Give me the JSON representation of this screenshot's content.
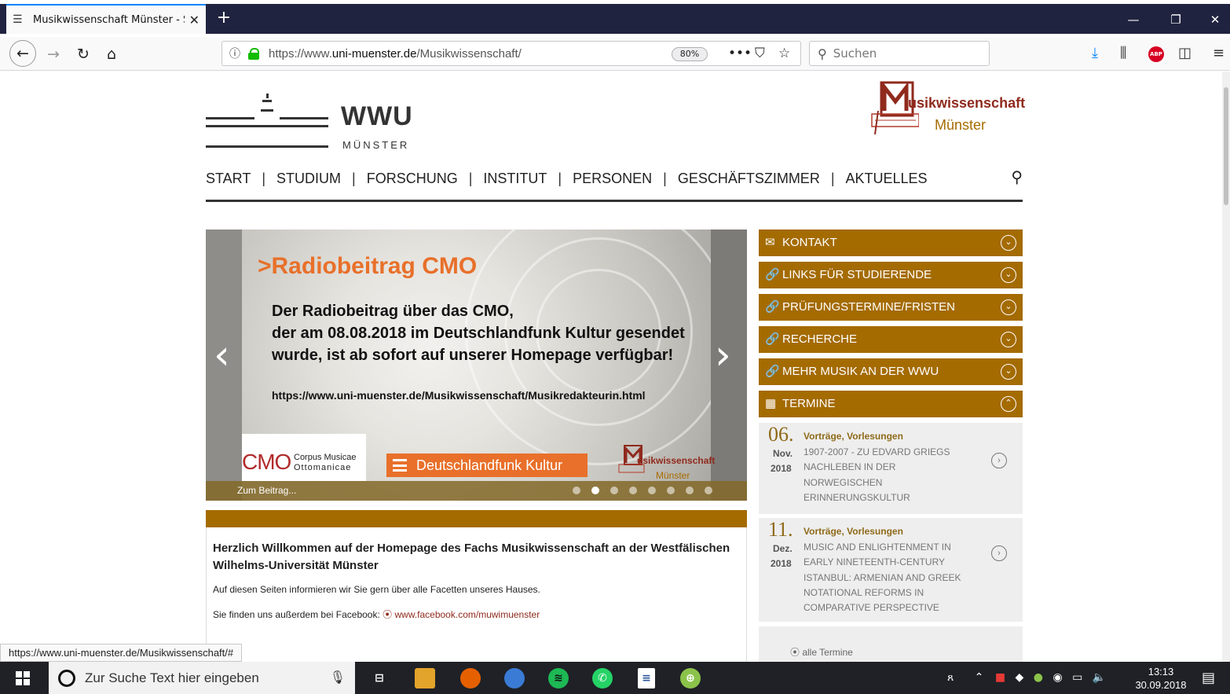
{
  "browser": {
    "tab_title": "Musikwissenschaft Münster - S",
    "new_tab": "+",
    "url_prefix": "https://www.",
    "url_domain": "uni-muenster.de",
    "url_path": "/Musikwissenschaft/",
    "zoom": "80%",
    "search_placeholder": "Suchen",
    "status_url": "https://www.uni-muenster.de/Musikwissenschaft/#",
    "adblock": "ABP"
  },
  "site": {
    "wwu_word": "WWU",
    "wwu_sub": "MÜNSTER",
    "muwi_logo_line1": "usikwissenschaft",
    "muwi_logo_line2": "Münster",
    "nav": [
      "START",
      "STUDIUM",
      "FORSCHUNG",
      "INSTITUT",
      "PERSONEN",
      "GESCHÄFTSZIMMER",
      "AKTUELLES"
    ],
    "nav_sep": "|"
  },
  "slider": {
    "heading": ">Radiobeitrag CMO",
    "body_line1": "Der Radiobeitrag über das CMO,",
    "body_line2": "der am 08.08.2018 im Deutschlandfunk Kultur gesendet",
    "body_line3": "wurde, ist ab sofort auf unserer Homepage verfügbar!",
    "link": "https://www.uni-muenster.de/Musikwissenschaft/Musikredakteurin.html",
    "cmo": "CMO",
    "cmo_line1": "Corpus Musicae",
    "cmo_line2": "Ottomanicae",
    "dlf": "Deutschlandfunk Kultur",
    "logo_line1": "usikwissenschaft",
    "logo_line2": "Münster",
    "caption": "Zum Beitrag...",
    "dot_count": 8,
    "active_dot": 1
  },
  "welcome": {
    "heading": "Herzlich Willkommen auf der Homepage des Fachs Musikwissenschaft an der Westfälischen Wilhelms-Universität Münster",
    "p1": "Auf diesen Seiten informieren wir Sie gern über alle Facetten unseres Hauses.",
    "p2_prefix": "Sie finden uns außerdem bei Facebook: ",
    "p2_link": "www.facebook.com/muwimuenster"
  },
  "sidebar": {
    "items": [
      {
        "icon": "envelope-icon",
        "label": "KONTAKT"
      },
      {
        "icon": "link-icon",
        "label": "LINKS FÜR STUDIERENDE"
      },
      {
        "icon": "link-icon",
        "label": "PRÜFUNGSTERMINE/FRISTEN"
      },
      {
        "icon": "link-icon",
        "label": "RECHERCHE"
      },
      {
        "icon": "link-icon",
        "label": "MEHR MUSIK AN DER WWU"
      },
      {
        "icon": "calendar-icon",
        "label": "TERMINE"
      }
    ],
    "events": [
      {
        "day": "06.",
        "month": "Nov.",
        "year": "2018",
        "category": "Vorträge, Vorlesungen",
        "title": "1907-2007 - ZU EDVARD GRIEGS NACHLEBEN IN DER NORWEGISCHEN ERINNERUNGSKULTUR"
      },
      {
        "day": "11.",
        "month": "Dez.",
        "year": "2018",
        "category": "Vorträge, Vorlesungen",
        "title": "MUSIC AND ENLIGHTENMENT IN EARLY NINETEENTH-CENTURY ISTANBUL: ARMENIAN AND GREEK NOTATIONAL REFORMS IN COMPARATIVE PERSPECTIVE"
      }
    ],
    "all_events": "alle Termine"
  },
  "taskbar": {
    "search_placeholder": "Zur Suche Text hier eingeben",
    "time": "13:13",
    "date": "30.09.2018"
  },
  "colors": {
    "accent": "#a46b00",
    "brand_red": "#8f2a1d",
    "slide_orange": "#e8702a",
    "firefox_dark": "#202340"
  }
}
